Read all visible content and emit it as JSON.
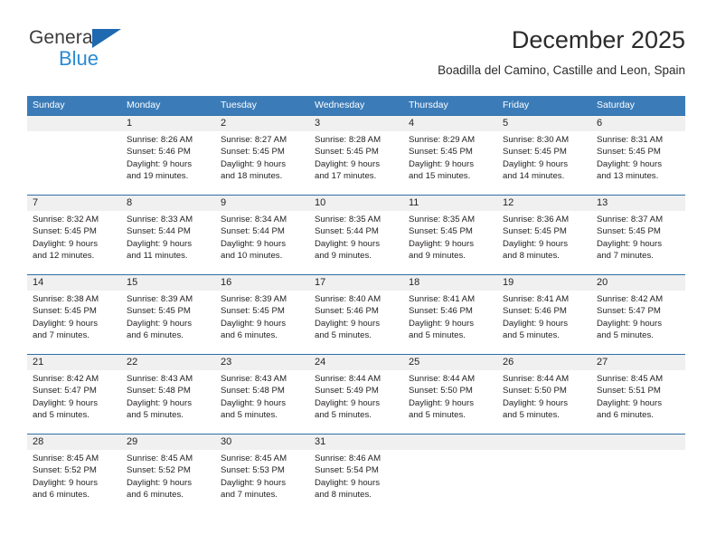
{
  "brand": {
    "name_part1": "General",
    "name_part2": "Blue",
    "triangle_color": "#1e69b0",
    "blue_text_color": "#2a8ad4"
  },
  "header": {
    "title": "December 2025",
    "subtitle": "Boadilla del Camino, Castille and Leon, Spain"
  },
  "theme": {
    "header_row_bg": "#3b7cb8",
    "row_border": "#2f6ea5",
    "daynum_band_bg": "#f0f0f0",
    "text": "#231f20"
  },
  "weekdays": [
    "Sunday",
    "Monday",
    "Tuesday",
    "Wednesday",
    "Thursday",
    "Friday",
    "Saturday"
  ],
  "weeks": [
    [
      {
        "day": "",
        "sunrise": "",
        "sunset": "",
        "daylight1": "",
        "daylight2": ""
      },
      {
        "day": "1",
        "sunrise": "Sunrise: 8:26 AM",
        "sunset": "Sunset: 5:46 PM",
        "daylight1": "Daylight: 9 hours",
        "daylight2": "and 19 minutes."
      },
      {
        "day": "2",
        "sunrise": "Sunrise: 8:27 AM",
        "sunset": "Sunset: 5:45 PM",
        "daylight1": "Daylight: 9 hours",
        "daylight2": "and 18 minutes."
      },
      {
        "day": "3",
        "sunrise": "Sunrise: 8:28 AM",
        "sunset": "Sunset: 5:45 PM",
        "daylight1": "Daylight: 9 hours",
        "daylight2": "and 17 minutes."
      },
      {
        "day": "4",
        "sunrise": "Sunrise: 8:29 AM",
        "sunset": "Sunset: 5:45 PM",
        "daylight1": "Daylight: 9 hours",
        "daylight2": "and 15 minutes."
      },
      {
        "day": "5",
        "sunrise": "Sunrise: 8:30 AM",
        "sunset": "Sunset: 5:45 PM",
        "daylight1": "Daylight: 9 hours",
        "daylight2": "and 14 minutes."
      },
      {
        "day": "6",
        "sunrise": "Sunrise: 8:31 AM",
        "sunset": "Sunset: 5:45 PM",
        "daylight1": "Daylight: 9 hours",
        "daylight2": "and 13 minutes."
      }
    ],
    [
      {
        "day": "7",
        "sunrise": "Sunrise: 8:32 AM",
        "sunset": "Sunset: 5:45 PM",
        "daylight1": "Daylight: 9 hours",
        "daylight2": "and 12 minutes."
      },
      {
        "day": "8",
        "sunrise": "Sunrise: 8:33 AM",
        "sunset": "Sunset: 5:44 PM",
        "daylight1": "Daylight: 9 hours",
        "daylight2": "and 11 minutes."
      },
      {
        "day": "9",
        "sunrise": "Sunrise: 8:34 AM",
        "sunset": "Sunset: 5:44 PM",
        "daylight1": "Daylight: 9 hours",
        "daylight2": "and 10 minutes."
      },
      {
        "day": "10",
        "sunrise": "Sunrise: 8:35 AM",
        "sunset": "Sunset: 5:44 PM",
        "daylight1": "Daylight: 9 hours",
        "daylight2": "and 9 minutes."
      },
      {
        "day": "11",
        "sunrise": "Sunrise: 8:35 AM",
        "sunset": "Sunset: 5:45 PM",
        "daylight1": "Daylight: 9 hours",
        "daylight2": "and 9 minutes."
      },
      {
        "day": "12",
        "sunrise": "Sunrise: 8:36 AM",
        "sunset": "Sunset: 5:45 PM",
        "daylight1": "Daylight: 9 hours",
        "daylight2": "and 8 minutes."
      },
      {
        "day": "13",
        "sunrise": "Sunrise: 8:37 AM",
        "sunset": "Sunset: 5:45 PM",
        "daylight1": "Daylight: 9 hours",
        "daylight2": "and 7 minutes."
      }
    ],
    [
      {
        "day": "14",
        "sunrise": "Sunrise: 8:38 AM",
        "sunset": "Sunset: 5:45 PM",
        "daylight1": "Daylight: 9 hours",
        "daylight2": "and 7 minutes."
      },
      {
        "day": "15",
        "sunrise": "Sunrise: 8:39 AM",
        "sunset": "Sunset: 5:45 PM",
        "daylight1": "Daylight: 9 hours",
        "daylight2": "and 6 minutes."
      },
      {
        "day": "16",
        "sunrise": "Sunrise: 8:39 AM",
        "sunset": "Sunset: 5:45 PM",
        "daylight1": "Daylight: 9 hours",
        "daylight2": "and 6 minutes."
      },
      {
        "day": "17",
        "sunrise": "Sunrise: 8:40 AM",
        "sunset": "Sunset: 5:46 PM",
        "daylight1": "Daylight: 9 hours",
        "daylight2": "and 5 minutes."
      },
      {
        "day": "18",
        "sunrise": "Sunrise: 8:41 AM",
        "sunset": "Sunset: 5:46 PM",
        "daylight1": "Daylight: 9 hours",
        "daylight2": "and 5 minutes."
      },
      {
        "day": "19",
        "sunrise": "Sunrise: 8:41 AM",
        "sunset": "Sunset: 5:46 PM",
        "daylight1": "Daylight: 9 hours",
        "daylight2": "and 5 minutes."
      },
      {
        "day": "20",
        "sunrise": "Sunrise: 8:42 AM",
        "sunset": "Sunset: 5:47 PM",
        "daylight1": "Daylight: 9 hours",
        "daylight2": "and 5 minutes."
      }
    ],
    [
      {
        "day": "21",
        "sunrise": "Sunrise: 8:42 AM",
        "sunset": "Sunset: 5:47 PM",
        "daylight1": "Daylight: 9 hours",
        "daylight2": "and 5 minutes."
      },
      {
        "day": "22",
        "sunrise": "Sunrise: 8:43 AM",
        "sunset": "Sunset: 5:48 PM",
        "daylight1": "Daylight: 9 hours",
        "daylight2": "and 5 minutes."
      },
      {
        "day": "23",
        "sunrise": "Sunrise: 8:43 AM",
        "sunset": "Sunset: 5:48 PM",
        "daylight1": "Daylight: 9 hours",
        "daylight2": "and 5 minutes."
      },
      {
        "day": "24",
        "sunrise": "Sunrise: 8:44 AM",
        "sunset": "Sunset: 5:49 PM",
        "daylight1": "Daylight: 9 hours",
        "daylight2": "and 5 minutes."
      },
      {
        "day": "25",
        "sunrise": "Sunrise: 8:44 AM",
        "sunset": "Sunset: 5:50 PM",
        "daylight1": "Daylight: 9 hours",
        "daylight2": "and 5 minutes."
      },
      {
        "day": "26",
        "sunrise": "Sunrise: 8:44 AM",
        "sunset": "Sunset: 5:50 PM",
        "daylight1": "Daylight: 9 hours",
        "daylight2": "and 5 minutes."
      },
      {
        "day": "27",
        "sunrise": "Sunrise: 8:45 AM",
        "sunset": "Sunset: 5:51 PM",
        "daylight1": "Daylight: 9 hours",
        "daylight2": "and 6 minutes."
      }
    ],
    [
      {
        "day": "28",
        "sunrise": "Sunrise: 8:45 AM",
        "sunset": "Sunset: 5:52 PM",
        "daylight1": "Daylight: 9 hours",
        "daylight2": "and 6 minutes."
      },
      {
        "day": "29",
        "sunrise": "Sunrise: 8:45 AM",
        "sunset": "Sunset: 5:52 PM",
        "daylight1": "Daylight: 9 hours",
        "daylight2": "and 6 minutes."
      },
      {
        "day": "30",
        "sunrise": "Sunrise: 8:45 AM",
        "sunset": "Sunset: 5:53 PM",
        "daylight1": "Daylight: 9 hours",
        "daylight2": "and 7 minutes."
      },
      {
        "day": "31",
        "sunrise": "Sunrise: 8:46 AM",
        "sunset": "Sunset: 5:54 PM",
        "daylight1": "Daylight: 9 hours",
        "daylight2": "and 8 minutes."
      },
      {
        "day": "",
        "sunrise": "",
        "sunset": "",
        "daylight1": "",
        "daylight2": ""
      },
      {
        "day": "",
        "sunrise": "",
        "sunset": "",
        "daylight1": "",
        "daylight2": ""
      },
      {
        "day": "",
        "sunrise": "",
        "sunset": "",
        "daylight1": "",
        "daylight2": ""
      }
    ]
  ]
}
